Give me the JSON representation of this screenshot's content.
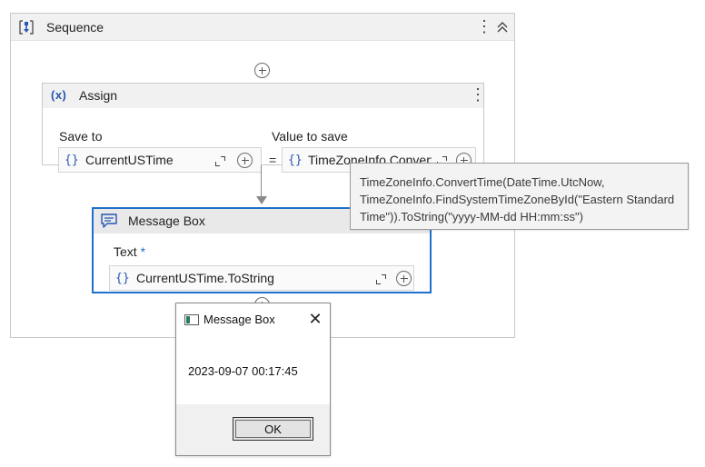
{
  "sequence": {
    "title": "Sequence"
  },
  "assign": {
    "title": "Assign",
    "icon_label": "(x)",
    "save_to_label": "Save to",
    "save_to_value": "CurrentUSTime",
    "value_label": "Value to save",
    "value_value": "TimeZoneInfo.Convert",
    "equals": "=",
    "brace": "{}"
  },
  "message_box_activity": {
    "title": "Message Box",
    "text_label": "Text",
    "required_mark": "*",
    "text_value": "CurrentUSTime.ToString",
    "brace": "{}"
  },
  "tooltip": {
    "text": "TimeZoneInfo.ConvertTime(DateTime.UtcNow,\nTimeZoneInfo.FindSystemTimeZoneById(\"Eastern Standard\nTime\")).ToString(\"yyyy-MM-dd HH:mm:ss\")"
  },
  "dialog": {
    "title": "Message Box",
    "close_glyph": "✕",
    "message": "2023-09-07 00:17:45",
    "ok_label": "OK"
  },
  "icons": [
    "sequence-icon",
    "kebab-menu-icon",
    "collapse-icon",
    "add-icon",
    "variable-icon",
    "expand-icon",
    "message-icon",
    "app-window-icon",
    "close-icon"
  ],
  "colors": {
    "accent": "#1e6fce",
    "brace": "#2456b3",
    "header_bg": "#f1f1f1"
  }
}
